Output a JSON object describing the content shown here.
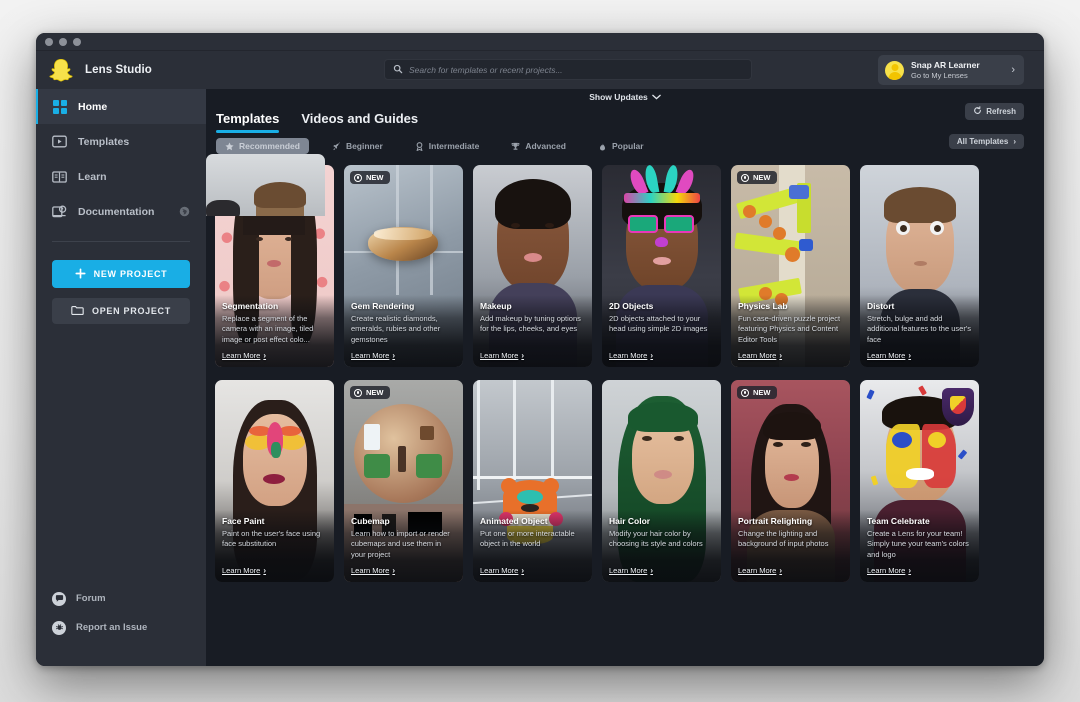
{
  "window": {
    "app_title": "Lens Studio",
    "traffic_lights": [
      "close",
      "minimize",
      "zoom"
    ]
  },
  "search": {
    "placeholder": "Search for templates or recent projects...",
    "value": "",
    "icon": "search-icon"
  },
  "account": {
    "name": "Snap AR Learner",
    "subtitle": "Go to My Lenses",
    "chevron": "›",
    "avatar_color": "#f7e14a"
  },
  "sidebar": {
    "items": [
      {
        "label": "Home",
        "icon": "grid-icon",
        "active": true,
        "external": false
      },
      {
        "label": "Templates",
        "icon": "template-frame-icon",
        "active": false,
        "external": false
      },
      {
        "label": "Learn",
        "icon": "book-icon",
        "active": false,
        "external": false
      },
      {
        "label": "Documentation",
        "icon": "doc-icon",
        "active": false,
        "external": true,
        "external_icon": "globe-icon"
      }
    ],
    "new_project_label": "NEW PROJECT",
    "open_project_label": "OPEN PROJECT",
    "footer_items": [
      {
        "label": "Forum",
        "icon": "chat-bubble-icon"
      },
      {
        "label": "Report an Issue",
        "icon": "bug-icon"
      }
    ]
  },
  "main": {
    "show_updates_label": "Show Updates",
    "show_updates_chevron": "⌄",
    "refresh_label": "Refresh",
    "refresh_icon": "refresh-icon",
    "all_templates_label": "All Templates",
    "all_templates_chevron": "›",
    "tabs": [
      {
        "label": "Templates",
        "active": true
      },
      {
        "label": "Videos and Guides",
        "active": false
      }
    ],
    "filters": [
      {
        "label": "Recommended",
        "icon": "star-icon",
        "selected": true
      },
      {
        "label": "Beginner",
        "icon": "rocket-icon",
        "selected": false
      },
      {
        "label": "Intermediate",
        "icon": "medal-icon",
        "selected": false
      },
      {
        "label": "Advanced",
        "icon": "trophy-icon",
        "selected": false
      },
      {
        "label": "Popular",
        "icon": "flame-icon",
        "selected": false
      }
    ],
    "learn_more_label": "Learn More",
    "learn_more_chevron": "›",
    "new_badge_label": "NEW",
    "cards": [
      {
        "title": "Segmentation",
        "description": "Replace a segment of the camera with an image, tiled image or post effect colo...",
        "is_new": false,
        "art": "art-seg"
      },
      {
        "title": "Gem Rendering",
        "description": "Create realistic diamonds, emeralds, rubies and other gemstones",
        "is_new": true,
        "art": "art-gem"
      },
      {
        "title": "Makeup",
        "description": "Add makeup by tuning options for the lips, cheeks, and eyes",
        "is_new": false,
        "art": "art-makeup"
      },
      {
        "title": "2D Objects",
        "description": "2D objects attached to your head using simple 2D images",
        "is_new": false,
        "art": "art-2d"
      },
      {
        "title": "Physics Lab",
        "description": "Fun case-driven puzzle project featuring Physics and Content Editor Tools",
        "is_new": true,
        "art": "art-phys"
      },
      {
        "title": "Distort",
        "description": "Stretch, bulge and add additional features to the user's face",
        "is_new": false,
        "art": "art-dist"
      },
      {
        "title": "Face Paint",
        "description": "Paint on the user's face using face substitution",
        "is_new": false,
        "art": "art-fp"
      },
      {
        "title": "Cubemap",
        "description": "Learn how to import or render cubemaps and use them in your project",
        "is_new": true,
        "art": "art-cube"
      },
      {
        "title": "Animated Object",
        "description": "Put one or more interactable object in the world",
        "is_new": false,
        "art": "art-anim"
      },
      {
        "title": "Hair Color",
        "description": "Modify your hair color by choosing its style and colors",
        "is_new": false,
        "art": "art-hair"
      },
      {
        "title": "Portrait Relighting",
        "description": "Change the lighting and background of input photos",
        "is_new": true,
        "art": "art-port"
      },
      {
        "title": "Team Celebrate",
        "description": "Create a Lens for your team! Simply tune your team's colors and logo",
        "is_new": false,
        "art": "art-team"
      }
    ]
  },
  "colors": {
    "accent": "#19aee5",
    "window_bg": "#181c24",
    "panel_bg": "#2b2f38",
    "chip_selected": "#7e8693"
  }
}
